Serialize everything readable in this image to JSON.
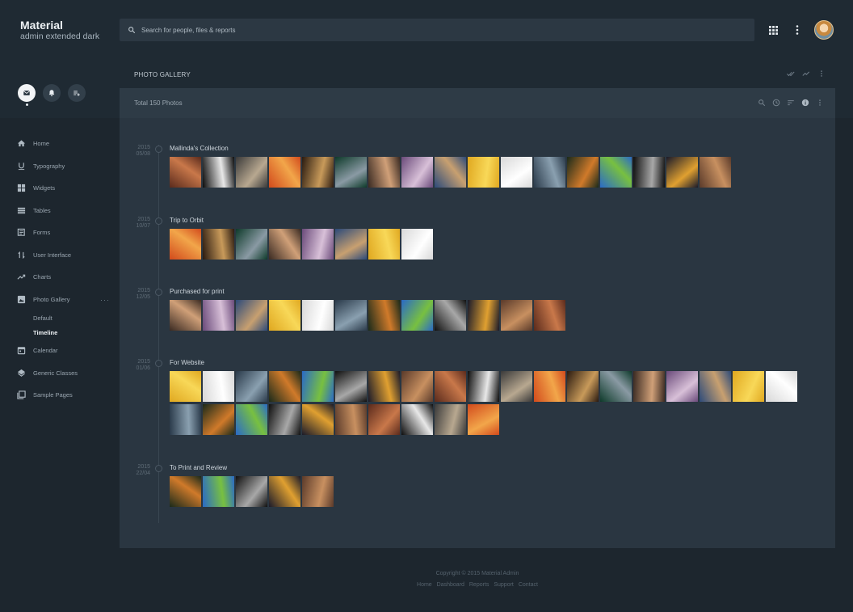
{
  "brand": {
    "title": "Material",
    "subtitle": "admin extended dark"
  },
  "search": {
    "placeholder": "Search for people, files & reports",
    "value": ""
  },
  "nav": [
    {
      "label": "Home",
      "icon": "home-icon"
    },
    {
      "label": "Typography",
      "icon": "underline-icon"
    },
    {
      "label": "Widgets",
      "icon": "widgets-icon"
    },
    {
      "label": "Tables",
      "icon": "list-icon"
    },
    {
      "label": "Forms",
      "icon": "forms-icon"
    },
    {
      "label": "User Interface",
      "icon": "swap-icon"
    },
    {
      "label": "Charts",
      "icon": "trending-icon"
    },
    {
      "label": "Photo Gallery",
      "icon": "photo-icon",
      "more": "···"
    },
    {
      "label": "Calendar",
      "icon": "calendar-icon"
    },
    {
      "label": "Generic Classes",
      "icon": "layers-icon"
    },
    {
      "label": "Sample Pages",
      "icon": "pages-icon"
    }
  ],
  "gallery_sub": [
    {
      "label": "Default",
      "active": false
    },
    {
      "label": "Timeline",
      "active": true
    }
  ],
  "page_title": "PHOTO GALLERY",
  "card_header": "Total 150 Photos",
  "colors": {
    "background": "#1d262e",
    "card": "#2a3641",
    "header": "#1f2a33"
  },
  "timeline": [
    {
      "year": "2015",
      "date": "05/08",
      "title": "Mallinda's Collection",
      "count": 17
    },
    {
      "year": "2015",
      "date": "10/07",
      "title": "Trip to Orbit",
      "count": 8
    },
    {
      "year": "2015",
      "date": "12/05",
      "title": "Purchased for print",
      "count": 12
    },
    {
      "year": "2015",
      "date": "01/06",
      "title": "For Website",
      "count": 29
    },
    {
      "year": "2015",
      "date": "22/04",
      "title": "To Print and Review",
      "count": 5
    }
  ],
  "footer": {
    "copyright": "Copyright © 2015 Material Admin",
    "links": [
      "Home",
      "Dashboard",
      "Reports",
      "Support",
      "Contact"
    ]
  }
}
